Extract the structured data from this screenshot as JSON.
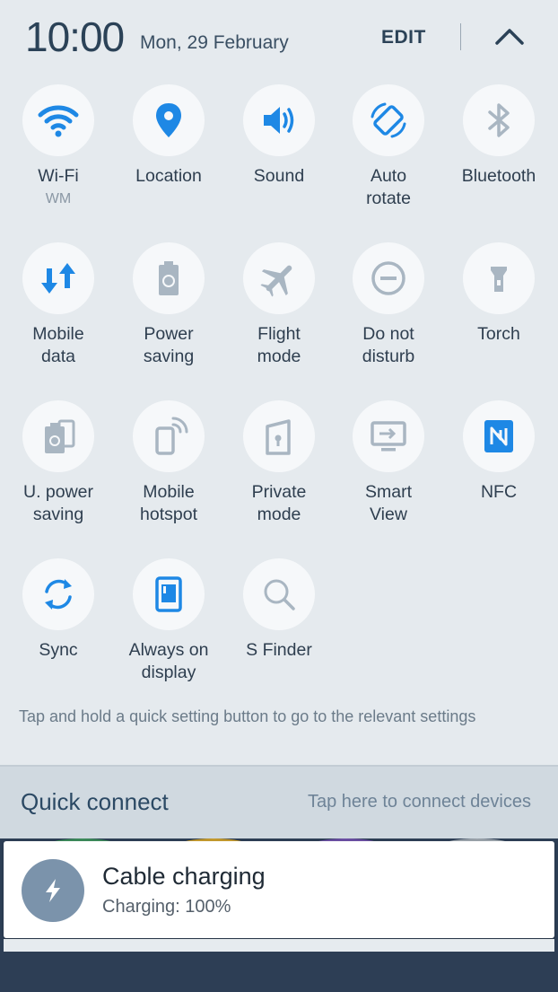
{
  "status": {
    "time": "10:00",
    "date": "Mon, 29 February",
    "edit_label": "EDIT"
  },
  "tiles": [
    {
      "label": "Wi-Fi",
      "sub": "WM",
      "icon": "wifi-icon",
      "active": true
    },
    {
      "label": "Location",
      "icon": "location-pin-icon",
      "active": true
    },
    {
      "label": "Sound",
      "icon": "speaker-icon",
      "active": true
    },
    {
      "label": "Auto\nrotate",
      "icon": "auto-rotate-icon",
      "active": true
    },
    {
      "label": "Bluetooth",
      "icon": "bluetooth-icon",
      "active": false
    },
    {
      "label": "Mobile\ndata",
      "icon": "mobile-data-icon",
      "active": true
    },
    {
      "label": "Power\nsaving",
      "icon": "power-saving-icon",
      "active": false
    },
    {
      "label": "Flight\nmode",
      "icon": "airplane-icon",
      "active": false
    },
    {
      "label": "Do not\ndisturb",
      "icon": "do-not-disturb-icon",
      "active": false
    },
    {
      "label": "Torch",
      "icon": "torch-icon",
      "active": false
    },
    {
      "label": "U. power\nsaving",
      "icon": "ultra-power-saving-icon",
      "active": false
    },
    {
      "label": "Mobile\nhotspot",
      "icon": "hotspot-icon",
      "active": false
    },
    {
      "label": "Private\nmode",
      "icon": "private-mode-icon",
      "active": false
    },
    {
      "label": "Smart\nView",
      "icon": "smart-view-icon",
      "active": false
    },
    {
      "label": "NFC",
      "icon": "nfc-icon",
      "active": true
    },
    {
      "label": "Sync",
      "icon": "sync-icon",
      "active": true
    },
    {
      "label": "Always on\ndisplay",
      "icon": "always-on-display-icon",
      "active": true
    },
    {
      "label": "S Finder",
      "icon": "search-icon",
      "active": false
    }
  ],
  "hint": "Tap and hold a quick setting button to go to the relevant settings",
  "quick_connect": {
    "title": "Quick connect",
    "hint": "Tap here to connect devices"
  },
  "notification": {
    "title": "Cable charging",
    "subtitle": "Charging: 100%",
    "icon": "lightning-bolt-icon"
  },
  "colors": {
    "active_icon": "#1e88e5",
    "inactive_icon": "#a9b6c2",
    "panel": "#e5eaee",
    "notification_icon_bg": "#7b93ab"
  }
}
